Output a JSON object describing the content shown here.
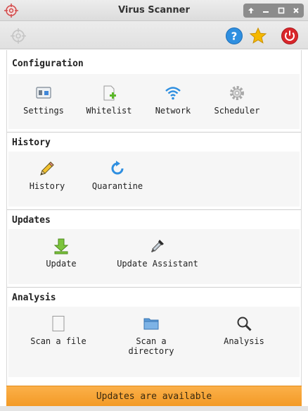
{
  "window": {
    "title": "Virus Scanner"
  },
  "titlebar": {
    "app_icon": "crosshair-logo-icon",
    "buttons": [
      "arrow-up-icon",
      "minimize-icon",
      "maximize-icon",
      "close-icon"
    ]
  },
  "toolbar": {
    "logo_icon": "crosshair-logo-icon",
    "help_icon": "help-icon",
    "favorite_icon": "star-icon",
    "power_icon": "power-icon"
  },
  "sections": {
    "configuration": {
      "title": "Configuration",
      "items": [
        {
          "label": "Settings",
          "icon": "settings-icon"
        },
        {
          "label": "Whitelist",
          "icon": "whitelist-icon"
        },
        {
          "label": "Network",
          "icon": "wifi-icon"
        },
        {
          "label": "Scheduler",
          "icon": "gear-icon"
        }
      ]
    },
    "history": {
      "title": "History",
      "items": [
        {
          "label": "History",
          "icon": "pencil-icon"
        },
        {
          "label": "Quarantine",
          "icon": "refresh-icon"
        }
      ]
    },
    "updates": {
      "title": "Updates",
      "items": [
        {
          "label": "Update",
          "icon": "download-arrow-icon"
        },
        {
          "label": "Update Assistant",
          "icon": "eyedropper-icon"
        }
      ]
    },
    "analysis": {
      "title": "Analysis",
      "items": [
        {
          "label": "Scan a file",
          "icon": "file-icon"
        },
        {
          "label": "Scan a\ndirectory",
          "icon": "folder-icon"
        },
        {
          "label": "Analysis",
          "icon": "magnifier-icon"
        }
      ]
    }
  },
  "notification": {
    "text": "Updates are available"
  },
  "colors": {
    "accent": "#f7a533",
    "help": "#2f8fe0",
    "star": "#f5b800",
    "power": "#d9262b"
  }
}
